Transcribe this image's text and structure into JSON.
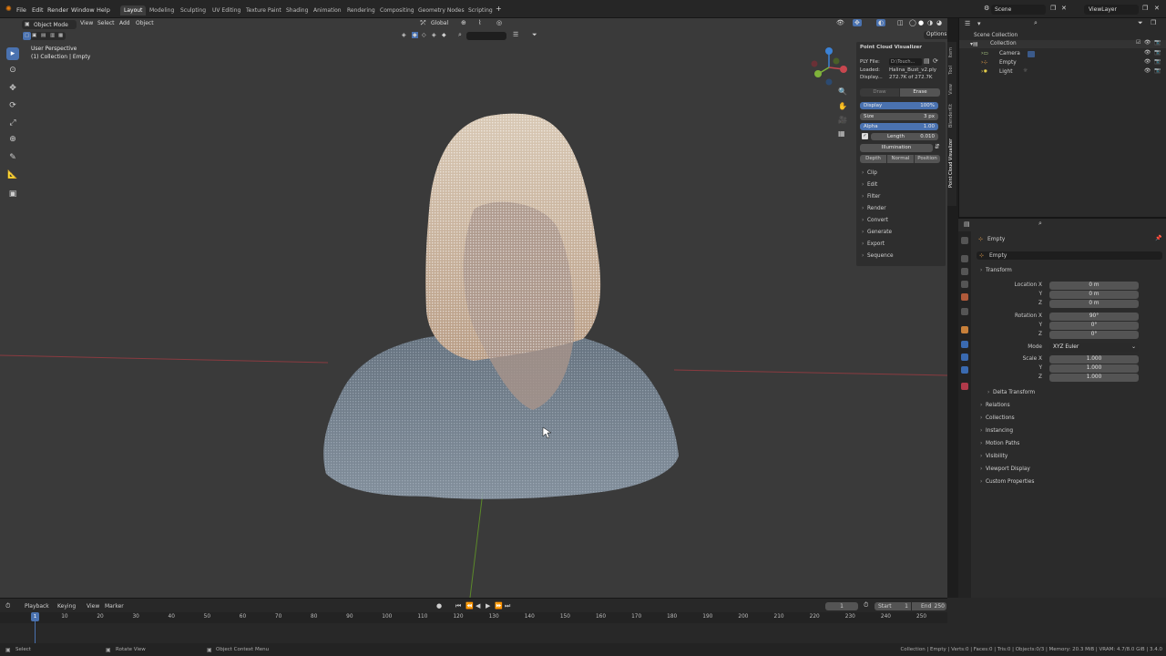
{
  "topbar": {
    "menus": [
      "File",
      "Edit",
      "Render",
      "Window",
      "Help"
    ],
    "workspaces": [
      "Layout",
      "Modeling",
      "Sculpting",
      "UV Editing",
      "Texture Paint",
      "Shading",
      "Animation",
      "Rendering",
      "Compositing",
      "Geometry Nodes",
      "Scripting"
    ],
    "active_workspace": "Layout",
    "scene": "Scene",
    "view_layer": "ViewLayer"
  },
  "viewport_header": {
    "mode": "Object Mode",
    "menus": [
      "View",
      "Select",
      "Add",
      "Object"
    ],
    "orientation": "Global",
    "options": "Options"
  },
  "viewport": {
    "perspective": "User Perspective",
    "collection_info": "(1) Collection | Empty"
  },
  "npanel": {
    "title": "Point Cloud Visualizer",
    "ply_label": "PLY File:",
    "ply_value": "D:\\Touch...",
    "loaded_label": "Loaded:",
    "loaded_value": "Halina_Bust_v2.ply",
    "display_label": "Display...",
    "display_value": "272.7K of 272.7K",
    "draw_label": "Draw",
    "erase_label": "Erase",
    "display_field": "Display",
    "display_pct": "100%",
    "size_field": "Size",
    "size_value": "3 px",
    "alpha_field": "Alpha",
    "alpha_value": "1.00",
    "length_field": "Length",
    "length_value": "0.010",
    "illumination": "Illumination",
    "shade_btns": [
      "Depth",
      "Normal",
      "Position"
    ],
    "sections": [
      "Clip",
      "Edit",
      "Filter",
      "Render",
      "Convert",
      "Generate",
      "Export",
      "Sequence"
    ],
    "side_tabs": [
      "Item",
      "Tool",
      "View",
      "BlenderKit",
      "Point Cloud Visualizer"
    ]
  },
  "outliner": {
    "root": "Scene Collection",
    "collection": "Collection",
    "items": [
      "Camera",
      "Empty",
      "Light"
    ]
  },
  "properties": {
    "object_name": "Empty",
    "data_name": "Empty",
    "transform_label": "Transform",
    "location_labels": [
      "Location X",
      "Y",
      "Z"
    ],
    "location_values": [
      "0 m",
      "0 m",
      "0 m"
    ],
    "rotation_labels": [
      "Rotation X",
      "Y",
      "Z"
    ],
    "rotation_values": [
      "90°",
      "0°",
      "0°"
    ],
    "mode_label": "Mode",
    "mode_value": "XYZ Euler",
    "scale_labels": [
      "Scale X",
      "Y",
      "Z"
    ],
    "scale_values": [
      "1.000",
      "1.000",
      "1.000"
    ],
    "sections": [
      "Delta Transform",
      "Relations",
      "Collections",
      "Instancing",
      "Motion Paths",
      "Visibility",
      "Viewport Display",
      "Custom Properties"
    ]
  },
  "timeline": {
    "menus": [
      "Playback",
      "Keying",
      "View",
      "Marker"
    ],
    "current_frame": "1",
    "start_label": "Start",
    "start": "1",
    "end_label": "End",
    "end": "250",
    "ticks": [
      "1",
      "10",
      "20",
      "30",
      "40",
      "50",
      "60",
      "70",
      "80",
      "90",
      "100",
      "110",
      "120",
      "130",
      "140",
      "150",
      "160",
      "170",
      "180",
      "190",
      "200",
      "210",
      "220",
      "230",
      "240",
      "250"
    ]
  },
  "statusbar": {
    "select": "Select",
    "rotate": "Rotate View",
    "context": "Object Context Menu",
    "stats": "Collection | Empty | Verts:0 | Faces:0 | Tris:0 | Objects:0/3 | Memory: 20.3 MiB | VRAM: 4.7/8.0 GiB | 3.4.0"
  },
  "colors": {
    "accent": "#4a72b0",
    "x_axis": "#c8474f",
    "y_axis": "#7fb33a",
    "z_axis": "#3b82d6"
  }
}
